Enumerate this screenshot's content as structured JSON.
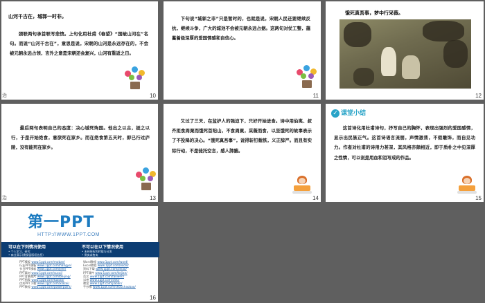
{
  "slides": [
    {
      "number": "10",
      "side_char": "治",
      "heading": "山河千古在，城郭一时非。",
      "paragraphs": [
        "颈联两句承首联写悲愤。上句化用杜甫《春望》“国破山河在”名句。而说“山河千古在”，意思是说，宋朝的山河是永远存在的，不会被元朝永远占领，言外之意是宋朝还会复兴，山河有重返之日。"
      ]
    },
    {
      "number": "11",
      "paragraphs": [
        "下句说“城郭之非”只是暂时的，也就是说，宋朝人民还要继续反抗，继续斗争，广大的城池不会被元朝永远占据。这两句对仗工整，蕴蓄着极深厚的爱国情感和自信心。"
      ]
    },
    {
      "number": "12",
      "heading": "饿死真吾事，梦中行采薇。"
    },
    {
      "number": "13",
      "side_char": "治",
      "paragraphs": [
        "最后两句表明自己的态度：决心城死殉国。他出之以古，挺之以行，于是开始绝食，意欲死在家乡。而在绝食第五天时，即已行过庐陵，没有能死在家乡。"
      ]
    },
    {
      "number": "14",
      "paragraphs": [
        "又过了三天，在监护人的强迫下，只好开始进食。诗中用伯夷、叔齐拒食周粟而饿死首阳山，不食周粟，采薇而食，以至饿死的故事表示了不投降的决心。“饿死真吾事”，说得斩钉截铁，义正辞严。而且有实际行动，不是徒托空言，感人肺腑。"
      ]
    },
    {
      "number": "15",
      "summary_title": "课堂小结",
      "paragraphs": [
        "这首诗化用杜甫诗句，抒写自己的胸怀，表现出强烈的爱国感情，显示出民族正气。这首诗语言流丽，声情激荡，不假雕饰，而自见功力。作者对杜甫的诗用力甚深，其风格亦颇相近，即于质朴之中见深厚之性情，可以说是用血和泪写成的作品。"
      ]
    },
    {
      "number": "16",
      "logo_main": "第一PPT",
      "logo_url": "HTTP://WWW.1PPT.COM",
      "can_title": "可以在下列情况使用",
      "can_lines": [
        "• 个人学习、研究",
        "• 商业演示(需保留版权信息)",
        "• 教学演示"
      ],
      "cannot_title": "不可以在以下情况使用",
      "cannot_lines": [
        "• 未经授权的转载与分发",
        "• 倒卖或售卖"
      ],
      "left_links": [
        {
          "label": "PPT模板",
          "url": "www.1ppt.com/moban/"
        },
        {
          "label": "行业PPT模板",
          "url": "www.1ppt.com/hangye/"
        },
        {
          "label": "节日PPT模板",
          "url": "www.1ppt.com/jieri/"
        },
        {
          "label": "PPT素材",
          "url": "www.1ppt.com/sucai/"
        },
        {
          "label": "PPT背景图片",
          "url": "www.1ppt.com/beijing/"
        },
        {
          "label": "PPT图表",
          "url": "www.1ppt.com/tubiao/"
        },
        {
          "label": "优秀PPT下载",
          "url": "www.1ppt.com/xiazai/"
        },
        {
          "label": "PPT教程",
          "url": "www.1ppt.com/powerpoint/"
        }
      ],
      "right_links": [
        {
          "label": "Word教程",
          "url": "www.1ppt.com/word/"
        },
        {
          "label": "Excel教程",
          "url": "www.1ppt.com/excel/"
        },
        {
          "label": "资料下载",
          "url": "www.1ppt.com/ziliao/"
        },
        {
          "label": "PPT课件",
          "url": "www.1ppt.com/kejian/"
        },
        {
          "label": "范文",
          "url": "www.1ppt.com/fanwen/"
        },
        {
          "label": "试卷",
          "url": "www.1ppt.com/shiti/"
        },
        {
          "label": "教案",
          "url": "www.1ppt.com/jiaoan/"
        },
        {
          "label": "手抄报",
          "url": "www.1ppt.com/shouchaobao/"
        }
      ]
    }
  ],
  "colors": {
    "background": "#5f5f5f",
    "accent_blue": "#27a3c7",
    "ppt_blue": "#0c3d73"
  }
}
